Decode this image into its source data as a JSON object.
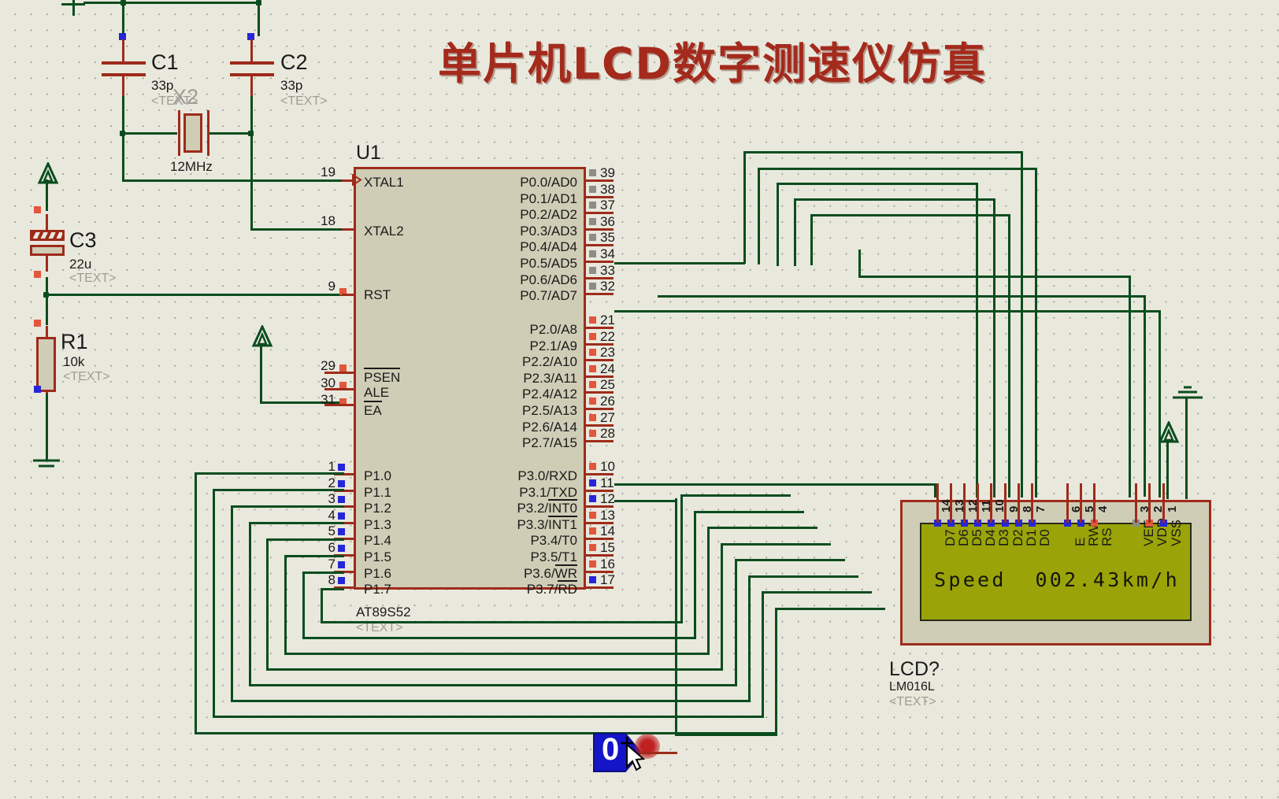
{
  "app": {
    "kind": "proteus-schematic-simulation",
    "title": "单片机LCD数字测速仪仿真"
  },
  "components": {
    "c1": {
      "ref": "C1",
      "value": "33p",
      "text": "<TEXT>"
    },
    "c2": {
      "ref": "C2",
      "value": "33p",
      "text": "<TEXT>"
    },
    "x2": {
      "ref": "X2",
      "value": "12MHz"
    },
    "c3": {
      "ref": "C3",
      "value": "22u",
      "text": "<TEXT>"
    },
    "r1": {
      "ref": "R1",
      "value": "10k",
      "text": "<TEXT>"
    },
    "u1": {
      "ref": "U1",
      "value": "AT89S52",
      "text": "<TEXT>",
      "left_pins": [
        {
          "num": "19",
          "label": "XTAL1",
          "state": "none"
        },
        {
          "num": "18",
          "label": "XTAL2",
          "state": "none"
        },
        {
          "num": "9",
          "label": "RST",
          "state": "red"
        },
        {
          "num": "29",
          "label": "PSEN",
          "state": "red",
          "overbar": true
        },
        {
          "num": "30",
          "label": "ALE",
          "state": "red"
        },
        {
          "num": "31",
          "label": "EA",
          "state": "red",
          "overbar": true
        }
      ],
      "port0": {
        "labels": [
          "P0.0/AD0",
          "P0.1/AD1",
          "P0.2/AD2",
          "P0.3/AD3",
          "P0.4/AD4",
          "P0.5/AD5",
          "P0.6/AD6",
          "P0.7/AD7"
        ],
        "nums": [
          "39",
          "38",
          "37",
          "36",
          "35",
          "34",
          "33",
          "32"
        ],
        "state": "gray"
      },
      "port2": {
        "labels": [
          "P2.0/A8",
          "P2.1/A9",
          "P2.2/A10",
          "P2.3/A11",
          "P2.4/A12",
          "P2.5/A13",
          "P2.6/A14",
          "P2.7/A15"
        ],
        "nums": [
          "21",
          "22",
          "23",
          "24",
          "25",
          "26",
          "27",
          "28"
        ],
        "state": "red"
      },
      "port1": {
        "labels": [
          "P1.0",
          "P1.1",
          "P1.2",
          "P1.3",
          "P1.4",
          "P1.5",
          "P1.6",
          "P1.7"
        ],
        "nums": [
          "1",
          "2",
          "3",
          "4",
          "5",
          "6",
          "7",
          "8"
        ],
        "state": "blue"
      },
      "port3": {
        "labels": [
          "P3.0/RXD",
          "P3.1/TXD",
          "P3.2/INT0",
          "P3.3/INT1",
          "P3.4/T0",
          "P3.5/T1",
          "P3.6/WR",
          "P3.7/RD"
        ],
        "nums": [
          "10",
          "11",
          "12",
          "13",
          "14",
          "15",
          "16",
          "17"
        ],
        "states": [
          "red",
          "blue",
          "blue",
          "red",
          "red",
          "red",
          "red",
          "blue"
        ],
        "overbars": [
          false,
          false,
          true,
          true,
          false,
          false,
          true,
          true
        ]
      }
    },
    "lcd": {
      "ref": "LCD?",
      "value": "LM016L",
      "text": "<TEXT>",
      "display_line1": "Speed  002.43km/h",
      "display_line2": "",
      "pins": [
        {
          "num": "14",
          "label": "D7",
          "state": "blue"
        },
        {
          "num": "13",
          "label": "D6",
          "state": "blue"
        },
        {
          "num": "12",
          "label": "D5",
          "state": "blue"
        },
        {
          "num": "11",
          "label": "D4",
          "state": "blue"
        },
        {
          "num": "10",
          "label": "D3",
          "state": "blue"
        },
        {
          "num": "9",
          "label": "D2",
          "state": "blue"
        },
        {
          "num": "8",
          "label": "D1",
          "state": "blue"
        },
        {
          "num": "7",
          "label": "D0",
          "state": "blue"
        },
        {
          "num": "6",
          "label": "E",
          "state": "blue"
        },
        {
          "num": "5",
          "label": "RW",
          "state": "blue"
        },
        {
          "num": "4",
          "label": "RS",
          "state": "red"
        },
        {
          "num": "3",
          "label": "VEE",
          "state": "gray"
        },
        {
          "num": "2",
          "label": "VDD",
          "state": "red"
        },
        {
          "num": "1",
          "label": "VSS",
          "state": "blue"
        }
      ]
    },
    "logic_button": {
      "state": "0"
    }
  },
  "colors": {
    "background": "#e9e8dd",
    "wire": "#0a4d1e",
    "component_outline": "#9e2b1a",
    "component_fill": "#cfcdb6",
    "title": "#a42a1c",
    "lcd_glass": "#9aa408",
    "pin_high": "#e2563c",
    "pin_low": "#2626d8",
    "pin_float": "#8d8d85"
  }
}
